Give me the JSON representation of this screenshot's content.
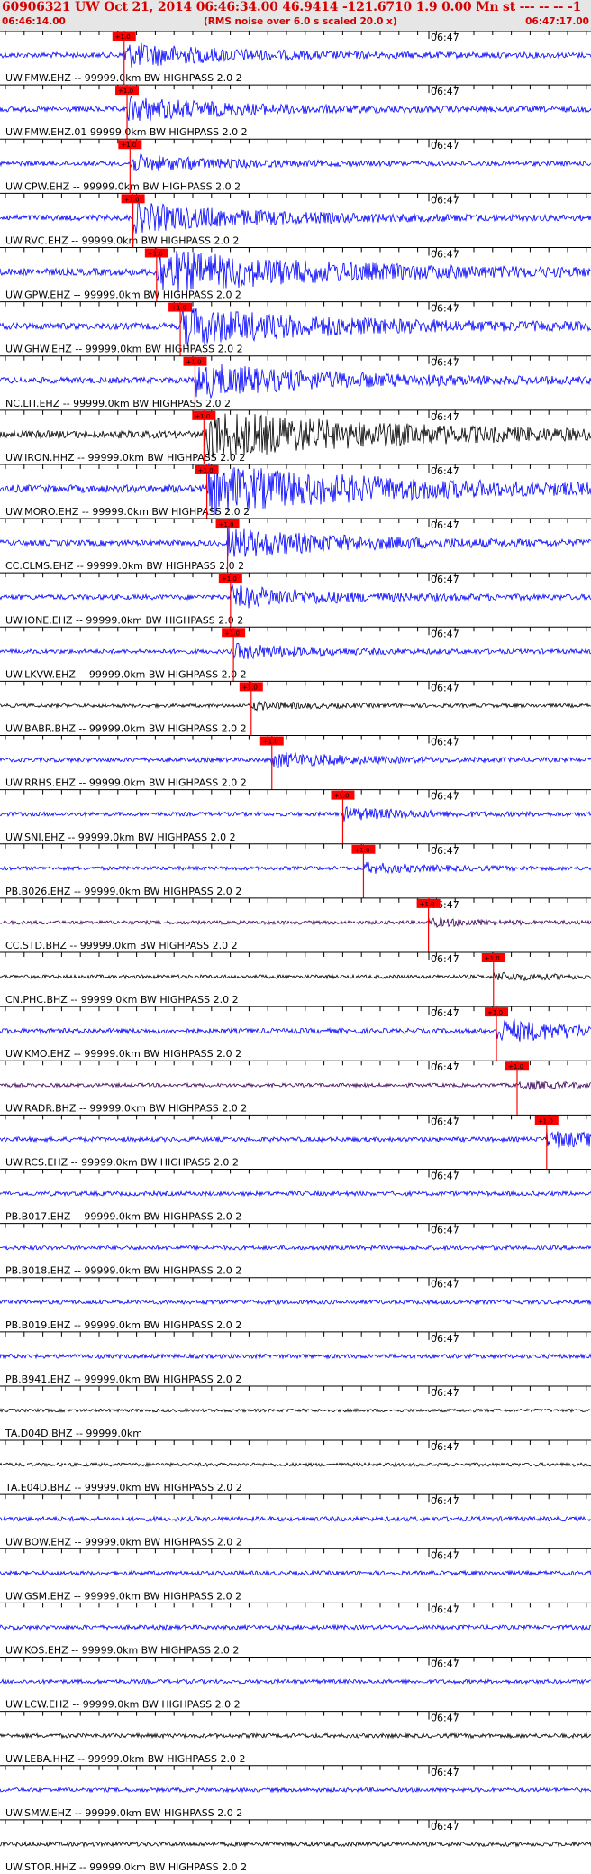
{
  "header": {
    "title": "60906321 UW Oct 21, 2014 06:46:34.00   46.9414 -121.6710  1.9 0.00 Mn st --- -- --  -1",
    "start_time": "06:46:14.00",
    "note": "(RMS noise over 6.0 s scaled 20.0 x)",
    "end_time": "06:47:17.00"
  },
  "minute_label": "06:47",
  "pick_label": "+1.0",
  "colors": {
    "blue": "#0000ff",
    "black": "#000000",
    "purple": "#3a005a",
    "pick": "#ff0000"
  },
  "traces": [
    {
      "label": "UW.FMW.EHZ -- 99999.0km BW  HIGHPASS  2.0  2",
      "color": "blue",
      "pick": 0.21,
      "amp": 0.5
    },
    {
      "label": "UW.FMW.EHZ.01 99999.0km BW  HIGHPASS  2.0  2",
      "color": "blue",
      "pick": 0.215,
      "amp": 0.5
    },
    {
      "label": "UW.CPW.EHZ -- 99999.0km BW  HIGHPASS  2.0  2",
      "color": "blue",
      "pick": 0.22,
      "amp": 0.35
    },
    {
      "label": "UW.RVC.EHZ -- 99999.0km BW  HIGHPASS  2.0  2",
      "color": "blue",
      "pick": 0.225,
      "amp": 0.6
    },
    {
      "label": "UW.GPW.EHZ -- 99999.0km BW  HIGHPASS  2.0  2",
      "color": "blue",
      "pick": 0.265,
      "amp": 0.9
    },
    {
      "label": "UW.GHW.EHZ -- 99999.0km BW  HIGHPASS  2.0  2",
      "color": "blue",
      "pick": 0.305,
      "amp": 0.8
    },
    {
      "label": "NC.LTI.EHZ -- 99999.0km BW  HIGHPASS  2.0  2",
      "color": "blue",
      "pick": 0.33,
      "amp": 0.7
    },
    {
      "label": "UW.IRON.HHZ -- 99999.0km BW  HIGHPASS  2.0  2",
      "color": "black",
      "pick": 0.345,
      "amp": 1.0
    },
    {
      "label": "UW.MORO.EHZ -- 99999.0km BW  HIGHPASS  2.0  2",
      "color": "blue",
      "pick": 0.35,
      "amp": 1.0
    },
    {
      "label": "CC.CLMS.EHZ -- 99999.0km BW  HIGHPASS  2.0  2",
      "color": "blue",
      "pick": 0.385,
      "amp": 0.6
    },
    {
      "label": "UW.IONE.EHZ -- 99999.0km BW  HIGHPASS  2.0  2",
      "color": "blue",
      "pick": 0.39,
      "amp": 0.45
    },
    {
      "label": "UW.LKVW.EHZ -- 99999.0km BW  HIGHPASS  2.0  2",
      "color": "blue",
      "pick": 0.395,
      "amp": 0.3
    },
    {
      "label": "UW.BABR.BHZ -- 99999.0km BW  HIGHPASS  2.0  2",
      "color": "black",
      "pick": 0.425,
      "amp": 0.15
    },
    {
      "label": "UW.RRHS.EHZ -- 99999.0km BW  HIGHPASS  2.0  2",
      "color": "blue",
      "pick": 0.46,
      "amp": 0.3
    },
    {
      "label": "UW.SNI.EHZ -- 99999.0km BW  HIGHPASS  2.0  2",
      "color": "blue",
      "pick": 0.58,
      "amp": 0.25
    },
    {
      "label": "PB.B026.EHZ -- 99999.0km BW  HIGHPASS  2.0  2",
      "color": "blue",
      "pick": 0.615,
      "amp": 0.2
    },
    {
      "label": "CC.STD.BHZ -- 99999.0km BW  HIGHPASS  2.0  2",
      "color": "purple",
      "pick": 0.725,
      "amp": 0.15
    },
    {
      "label": "CN.PHC.BHZ -- 99999.0km BW  HIGHPASS  2.0  2",
      "color": "black",
      "pick": 0.835,
      "amp": 0.15
    },
    {
      "label": "UW.KMO.EHZ -- 99999.0km BW  HIGHPASS  2.0  2",
      "color": "blue",
      "pick": 0.84,
      "amp": 0.45
    },
    {
      "label": "UW.RADR.BHZ -- 99999.0km BW  HIGHPASS  2.0  2",
      "color": "purple",
      "pick": 0.875,
      "amp": 0.15
    },
    {
      "label": "UW.RCS.EHZ -- 99999.0km BW  HIGHPASS  2.0  2",
      "color": "blue",
      "pick": 0.925,
      "amp": 0.35
    },
    {
      "label": "PB.B017.EHZ -- 99999.0km BW  HIGHPASS  2.0  2",
      "color": "blue",
      "pick": null,
      "amp": 0.3
    },
    {
      "label": "PB.B018.EHZ -- 99999.0km BW  HIGHPASS  2.0  2",
      "color": "blue",
      "pick": null,
      "amp": 0.25
    },
    {
      "label": "PB.B019.EHZ -- 99999.0km BW  HIGHPASS  2.0  2",
      "color": "blue",
      "pick": null,
      "amp": 0.25
    },
    {
      "label": "PB.B941.EHZ -- 99999.0km BW  HIGHPASS  2.0  2",
      "color": "blue",
      "pick": null,
      "amp": 0.3
    },
    {
      "label": "TA.D04D.BHZ -- 99999.0km",
      "color": "black",
      "pick": null,
      "amp": 0.02
    },
    {
      "label": "TA.E04D.BHZ -- 99999.0km BW  HIGHPASS  2.0  2",
      "color": "black",
      "pick": null,
      "amp": 0.12
    },
    {
      "label": "UW.BOW.EHZ -- 99999.0km BW  HIGHPASS  2.0  2",
      "color": "blue",
      "pick": null,
      "amp": 0.35
    },
    {
      "label": "UW.GSM.EHZ -- 99999.0km BW  HIGHPASS  2.0  2",
      "color": "blue",
      "pick": null,
      "amp": 0.3
    },
    {
      "label": "UW.KOS.EHZ -- 99999.0km BW  HIGHPASS  2.0  2",
      "color": "blue",
      "pick": null,
      "amp": 0.3
    },
    {
      "label": "UW.LCW.EHZ -- 99999.0km BW  HIGHPASS  2.0  2",
      "color": "blue",
      "pick": null,
      "amp": 0.25
    },
    {
      "label": "UW.LEBA.HHZ -- 99999.0km BW  HIGHPASS  2.0  2",
      "color": "black",
      "pick": null,
      "amp": 0.3
    },
    {
      "label": "UW.SMW.EHZ -- 99999.0km BW  HIGHPASS  2.0  2",
      "color": "blue",
      "pick": null,
      "amp": 0.25
    },
    {
      "label": "UW.STOR.HHZ -- 99999.0km BW  HIGHPASS  2.0  2",
      "color": "black",
      "pick": null,
      "amp": 0.3
    }
  ]
}
